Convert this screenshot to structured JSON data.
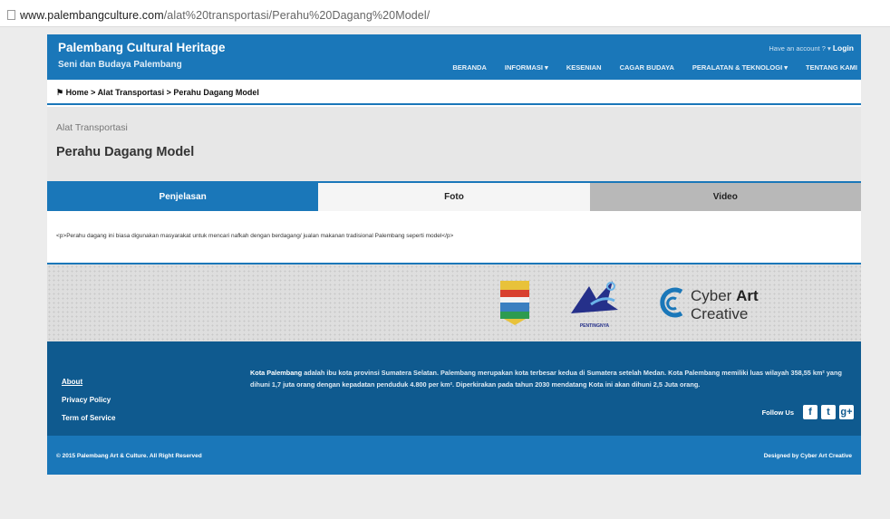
{
  "browser": {
    "url_host": "www.palembangculture.com",
    "url_path": "/alat%20transportasi/Perahu%20Dagang%20Model/"
  },
  "header": {
    "brand": "Palembang Cultural Heritage",
    "tagline": "Seni dan Budaya Palembang",
    "account_prompt": "Have an account ?",
    "login": "Login",
    "nav": [
      "BERANDA",
      "INFORMASI",
      "KESENIAN",
      "CAGAR BUDAYA",
      "PERALATAN & TEKNOLOGI",
      "TENTANG KAMI"
    ]
  },
  "breadcrumb": {
    "home": "Home",
    "separator": ">",
    "category": "Alat Transportasi",
    "current": "Perahu Dagang Model"
  },
  "page": {
    "category": "Alat Transportasi",
    "title": "Perahu Dagang Model"
  },
  "tabs": [
    "Penjelasan",
    "Foto",
    "Video"
  ],
  "content": {
    "text": "<p>Perahu dagang ini biasa digunakan masyarakat untuk mencari nafkah dengan berdagang/ jualan makanan tradisional Palembang seperti model</p>"
  },
  "sponsors": {
    "kemen_label": "PENTINGNYA",
    "cyber_word1": "Cyber",
    "cyber_word2": "Art",
    "cyber_word3": "Creative"
  },
  "footer": {
    "links": [
      "About",
      "Privacy Policy",
      "Term of Service"
    ],
    "about_lead": "Kota Palembang",
    "about_text": "adalah ibu kota provinsi Sumatera Selatan. Palembang merupakan kota terbesar kedua di Sumatera setelah Medan. Kota Palembang memiliki luas wilayah 358,55 km² yang dihuni 1,7 juta orang dengan kepadatan penduduk 4.800 per km². Diperkirakan pada tahun 2030 mendatang Kota ini akan dihuni 2,5 Juta orang.",
    "follow_label": "Follow Us",
    "social": [
      "f",
      "t",
      "g+"
    ]
  },
  "copyright": {
    "left": "© 2015 Palembang Art & Culture. All Right Reserved",
    "right": "Designed by Cyber Art Creative"
  },
  "colors": {
    "primary": "#1a77b9",
    "footer_dark": "#0f5a8f"
  }
}
